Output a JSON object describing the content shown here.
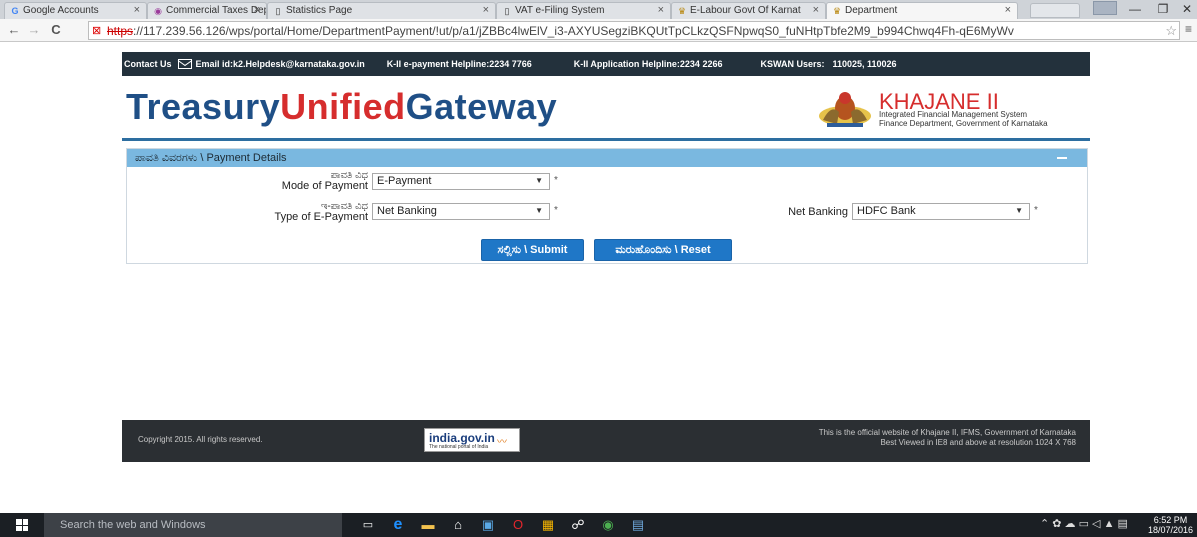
{
  "browser": {
    "tabs": [
      {
        "label": "Google Accounts",
        "icon": "google-icon",
        "active": false
      },
      {
        "label": "Commercial Taxes Depart",
        "icon": "site-icon",
        "active": false
      },
      {
        "label": "Statistics Page",
        "icon": "page-icon",
        "active": false
      },
      {
        "label": "VAT e-Filing System",
        "icon": "page-icon",
        "active": false
      },
      {
        "label": "E-Labour Govt Of Karnat",
        "icon": "emblem-icon",
        "active": false
      },
      {
        "label": "Department",
        "icon": "emblem-icon",
        "active": true
      }
    ],
    "url_scheme": "https",
    "url_rest": "://117.239.56.126/wps/portal/Home/DepartmentPayment/!ut/p/a1/jZBBc4lwElV_i3-AXYUSegziBKQUtTpCLkzQSFNpwqS0_fuNHtpTbfe2M9_b994Chwq4Fh-qE6MyWv"
  },
  "topbar": {
    "contact": "Contact Us",
    "email": "Email id:k2.Helpdesk@karnataka.gov.in",
    "epay_helpline": "K-II e-payment Helpline:2234 7766",
    "app_helpline": "K-II Application Helpline:2234 2266",
    "kswan_label": "KSWAN Users:",
    "kswan_numbers": "110025, 110026"
  },
  "header": {
    "logo_part1": "Treasury",
    "logo_part2": "Unified",
    "logo_part3": "Gateway",
    "khajane_title": "KHAJANE II",
    "khajane_sub1": "Integrated Financial Management System",
    "khajane_sub2": "Finance Department, Government of Karnataka"
  },
  "panel": {
    "title": "ಪಾವತಿ ವಿವರಗಳು \\ Payment Details",
    "mode_label_kn": "ಪಾವತಿ ವಿಧ",
    "mode_label_en": "Mode of Payment",
    "mode_value": "E-Payment",
    "type_label_kn": "ಇ-ಪಾವತಿ ವಿಧ",
    "type_label_en": "Type of E-Payment",
    "type_value": "Net Banking",
    "netbanking_label": "Net Banking",
    "netbanking_value": "HDFC Bank",
    "required_mark": "*",
    "submit_label": "ಸಲ್ಲಿಸು \\ Submit",
    "reset_label": "ಮರುಹೊಂದಿಸು \\ Reset"
  },
  "footer": {
    "copyright": "Copyright 2015. All rights reserved.",
    "indiagov": "india.gov.in",
    "indiagov_sub": "The national portal of India",
    "official_line1": "This is the official website of Khajane II, IFMS, Government of Karnataka",
    "official_line2": "Best Viewed in IE8 and above at resolution 1024 X 768"
  },
  "taskbar": {
    "search_placeholder": "Search the web and Windows",
    "time": "6:52 PM",
    "date": "18/07/2016"
  },
  "colors": {
    "brand_blue": "#1f4f86",
    "brand_red": "#d62d2d",
    "panel_header": "#7ab8e0",
    "button_blue": "#1f77c7",
    "topbar_bg": "#23313c"
  }
}
